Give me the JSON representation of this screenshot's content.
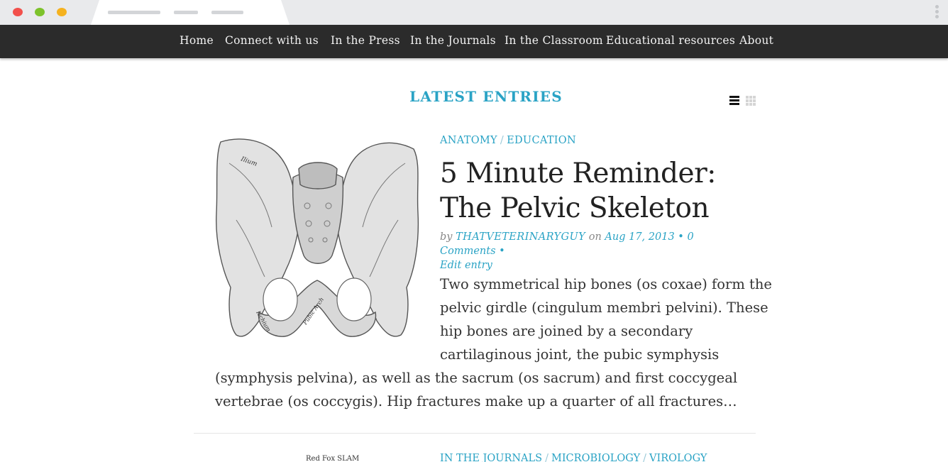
{
  "browser": {
    "controls": [
      "close",
      "minimize",
      "maximize"
    ]
  },
  "nav": {
    "items": [
      {
        "label": "Home"
      },
      {
        "label": "Connect with us"
      },
      {
        "label": "In the Press"
      },
      {
        "label": "In the Journals"
      },
      {
        "label": "In the Classroom"
      },
      {
        "label": "Educational resources"
      },
      {
        "label": "About"
      }
    ]
  },
  "section": {
    "heading": "LATEST ENTRIES",
    "view_options": [
      "list-view-icon",
      "grid-view-icon"
    ],
    "active_view": "list"
  },
  "entry": {
    "image_alt_label_1": "Ilium",
    "image_alt_label_2": "Pubic Arch",
    "image_alt_label_3": "Ischium",
    "category_1": "ANATOMY",
    "category_sep": "/",
    "category_2": "EDUCATION",
    "title": "5 Minute Reminder: The Pelvic Skeleton",
    "meta": {
      "by": "by",
      "author": "THATVETERINARYGUY",
      "on": "on",
      "date": "Aug 17, 2013",
      "bullet": "•",
      "comments": "0 Comments",
      "edit": "Edit entry"
    },
    "excerpt": {
      "line1": "Two symmetrical hip bones (os coxae) form the",
      "line2": "pelvic girdle (cingulum membri pelvini). These",
      "line3": "hip bones are joined by a secondary",
      "line4": "cartilaginous joint, the pubic symphysis",
      "line5": "(symphysis pelvina), as well as the sacrum (os sacrum) and first coccygeal",
      "line6": "vertebrae (os coccygis). Hip fractures make up a quarter of all fractures…"
    }
  },
  "next_entry": {
    "category_1": "IN THE JOURNALS",
    "category_2": "MICROBIOLOGY",
    "category_3": "VIROLOGY",
    "sep": "/",
    "image_caption": "Red Fox SLAM"
  },
  "colors": {
    "accent": "#2aa3c5",
    "nav_bg": "#2b2b2b",
    "chrome_bg": "#e9eaec"
  }
}
